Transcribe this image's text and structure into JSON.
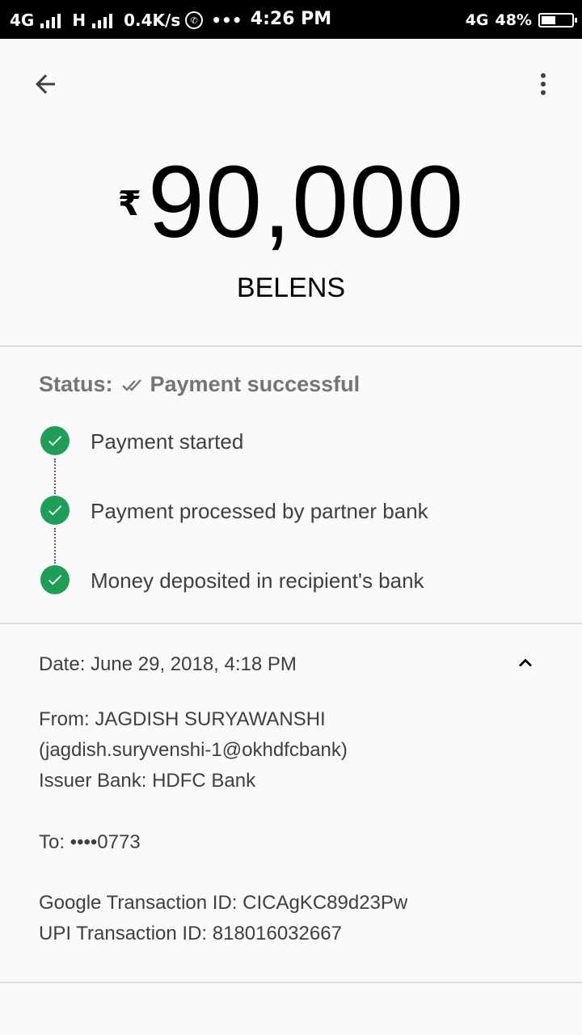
{
  "status_bar": {
    "net1": "4G",
    "net2": "H",
    "speed": "0.4K/s",
    "dots": "•••",
    "time": "4:26 PM",
    "net3": "4G",
    "battery_text": "48%",
    "battery_level": 0.48
  },
  "transaction": {
    "currency": "₹",
    "amount": "90,000",
    "payee": "BELENS"
  },
  "status": {
    "label": "Status:",
    "value": "Payment successful",
    "steps": [
      {
        "label": "Payment started"
      },
      {
        "label": "Payment processed by partner bank"
      },
      {
        "label": "Money deposited in recipient's bank"
      }
    ]
  },
  "details": {
    "date": "Date: June 29, 2018, 4:18 PM",
    "from": "From: JAGDISH SURYAWANSHI",
    "from_id": "(jagdish.suryvenshi-1@okhdfcbank)",
    "issuer": "Issuer Bank: HDFC Bank",
    "to": "To: ••••0773",
    "google_txn": "Google Transaction ID: CICAgKC89d23Pw",
    "upi_txn": "UPI Transaction ID: 818016032667"
  },
  "colors": {
    "success": "#1e9e57",
    "divider": "#dadce0"
  },
  "icons": {
    "back": "arrow-back-icon",
    "more": "more-vert-icon",
    "collapse": "chevron-up-icon",
    "step": "check-circle-icon",
    "status": "double-check-icon"
  }
}
